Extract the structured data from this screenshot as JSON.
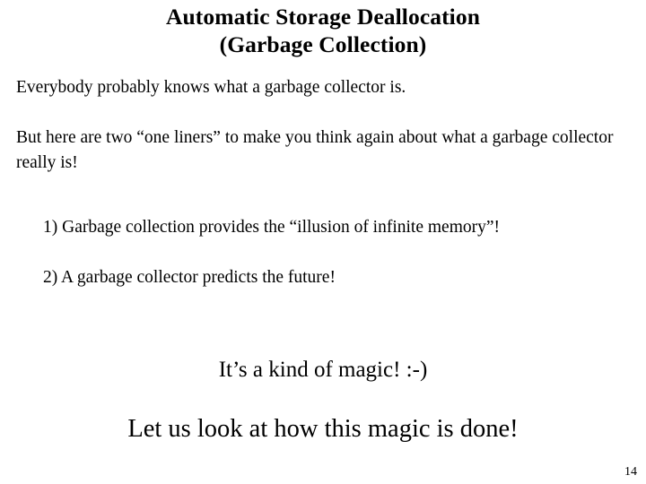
{
  "slide": {
    "title": {
      "line1": "Automatic Storage Deallocation",
      "line2": "(Garbage Collection)"
    },
    "paragraphs": [
      "Everybody probably knows what a garbage collector is.",
      "But here are two “one liners” to make you think again about what a garbage collector really is!"
    ],
    "list_items": [
      "1) Garbage collection provides the “illusion of infinite memory”!",
      "2) A garbage collector predicts the future!"
    ],
    "closing": {
      "line1": "It’s a kind of magic! :-)",
      "line2": "Let us look at how this magic is done!"
    },
    "slide_number": "14",
    "colors": {
      "background": "#ffffff",
      "text": "#000000"
    }
  }
}
